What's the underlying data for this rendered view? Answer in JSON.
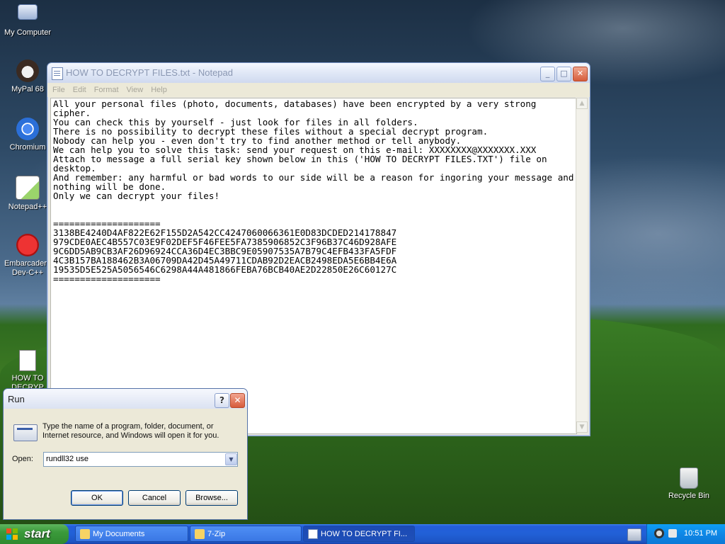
{
  "desktop_icons": [
    {
      "label": "My Computer",
      "icon": "my-computer-icon"
    },
    {
      "label": "MyPal 68",
      "icon": "mypal-browser-icon"
    },
    {
      "label": "Chromium",
      "icon": "chromium-icon"
    },
    {
      "label": "Notepad++",
      "icon": "notepadpp-icon"
    },
    {
      "label": "Embarcadero Dev-C++",
      "icon": "devcpp-icon"
    },
    {
      "label": "HOW TO DECRYP",
      "icon": "text-file-icon"
    },
    {
      "label": "Recycle Bin",
      "icon": "recycle-bin-icon"
    }
  ],
  "notepad": {
    "title": "HOW TO DECRYPT FILES.txt - Notepad",
    "menu": [
      "File",
      "Edit",
      "Format",
      "View",
      "Help"
    ],
    "content": "All your personal files (photo, documents, databases) have been encrypted by a very strong cipher.\nYou can check this by yourself - just look for files in all folders.\nThere is no possibility to decrypt these files without a special decrypt program.\nNobody can help you - even don't try to find another method or tell anybody.\nWe can help you to solve this task: send your request on this e-mail: XXXXXXXX@XXXXXXX.XXX\nAttach to message a full serial key shown below in this ('HOW TO DECRYPT FILES.TXT') file on desktop.\nAnd remember: any harmful or bad words to our side will be a reason for ingoring your message and nothing will be done.\nOnly we can decrypt your files!\n\n\n====================\n3138BE4240D4AF822E62F155D2A542CC4247060066361E0D83DCDED214178847\n979CDE0AEC4B557C03E9F02DEF5F46FEE5FA7385906852C3F96B37C46D928AFE\n9C6DD5AB9CB3AF26D96924CCA36D4EC3BBC9E05907535A7B79C4EFB433FA5FDF\n4C3B157BA188462B3A06709DA42D45A49711CDAB92D2EACB2498EDA5E6BB4E6A\n19535D5E525A5056546C6298A44A481866FEBA76BCB40AE2D22850E26C60127C\n===================="
  },
  "run_dialog": {
    "title": "Run",
    "help_label": "?",
    "close_label": "✕",
    "description": "Type the name of a program, folder, document, or Internet resource, and Windows will open it for you.",
    "open_label": "Open:",
    "open_value": "rundll32 use",
    "ok_label": "OK",
    "cancel_label": "Cancel",
    "browse_label": "Browse..."
  },
  "taskbar": {
    "start_label": "start",
    "tasks": [
      {
        "label": "My Documents",
        "icon": "folder-icon"
      },
      {
        "label": "7-Zip",
        "icon": "folder-icon"
      },
      {
        "label": "HOW TO DECRYPT FI...",
        "icon": "notepad-icon"
      }
    ],
    "clock": "10:51 PM"
  }
}
